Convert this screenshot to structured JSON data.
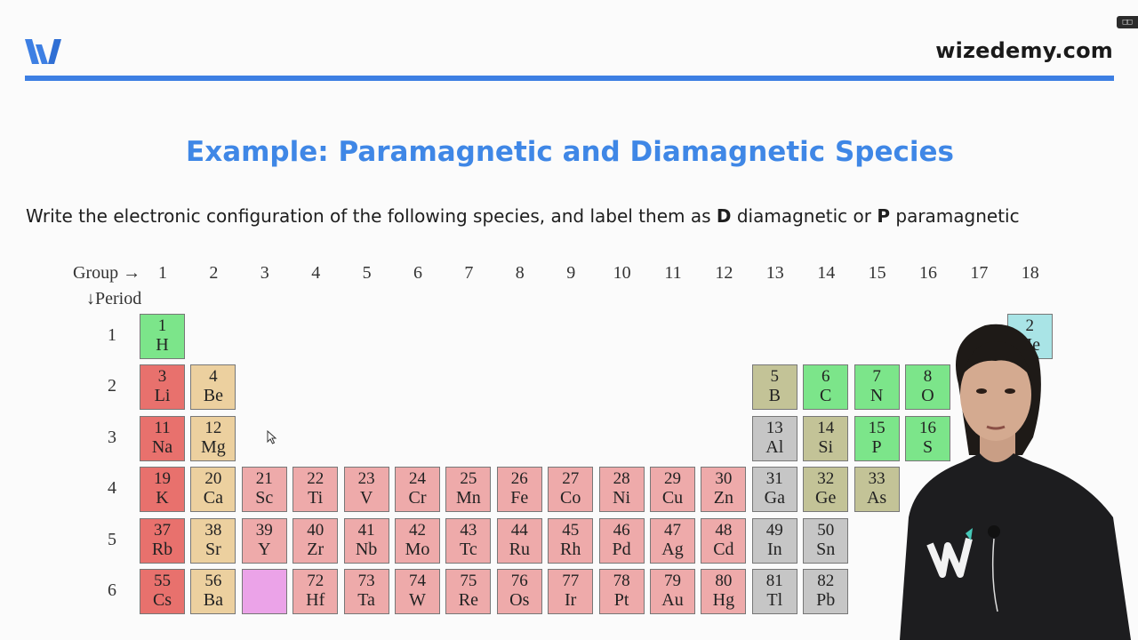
{
  "header": {
    "brand": "wizedemy.com",
    "logo_icon": "wizedemy-w-logo-icon",
    "accent_color": "#3d7fe3"
  },
  "slide": {
    "title": "Example: Paramagnetic and Diamagnetic Species",
    "question_part1": "Write the electronic configuration of the following species, and label them as ",
    "question_d": "D",
    "question_part2": " diamagnetic or ",
    "question_p": "P",
    "question_part3": " paramagnetic"
  },
  "table": {
    "group_label": "Group",
    "group_arrow": "→",
    "period_label": "Period",
    "period_arrow": "↓",
    "groups": [
      "1",
      "2",
      "3",
      "4",
      "5",
      "6",
      "7",
      "8",
      "9",
      "10",
      "11",
      "12",
      "13",
      "14",
      "15",
      "16",
      "17",
      "18"
    ],
    "periods": [
      "1",
      "2",
      "3",
      "4",
      "5",
      "6"
    ],
    "elements": [
      {
        "z": "1",
        "s": "H",
        "g": 1,
        "p": 1,
        "c": "nonmetal"
      },
      {
        "z": "2",
        "s": "He",
        "g": 18,
        "p": 1,
        "c": "noble"
      },
      {
        "z": "3",
        "s": "Li",
        "g": 1,
        "p": 2,
        "c": "alkali"
      },
      {
        "z": "4",
        "s": "Be",
        "g": 2,
        "p": 2,
        "c": "alkaline"
      },
      {
        "z": "5",
        "s": "B",
        "g": 13,
        "p": 2,
        "c": "metalloid"
      },
      {
        "z": "6",
        "s": "C",
        "g": 14,
        "p": 2,
        "c": "nonmetal"
      },
      {
        "z": "7",
        "s": "N",
        "g": 15,
        "p": 2,
        "c": "nonmetal"
      },
      {
        "z": "8",
        "s": "O",
        "g": 16,
        "p": 2,
        "c": "nonmetal"
      },
      {
        "z": "11",
        "s": "Na",
        "g": 1,
        "p": 3,
        "c": "alkali"
      },
      {
        "z": "12",
        "s": "Mg",
        "g": 2,
        "p": 3,
        "c": "alkaline"
      },
      {
        "z": "13",
        "s": "Al",
        "g": 13,
        "p": 3,
        "c": "post"
      },
      {
        "z": "14",
        "s": "Si",
        "g": 14,
        "p": 3,
        "c": "metalloid"
      },
      {
        "z": "15",
        "s": "P",
        "g": 15,
        "p": 3,
        "c": "nonmetal"
      },
      {
        "z": "16",
        "s": "S",
        "g": 16,
        "p": 3,
        "c": "nonmetal"
      },
      {
        "z": "19",
        "s": "K",
        "g": 1,
        "p": 4,
        "c": "alkali"
      },
      {
        "z": "20",
        "s": "Ca",
        "g": 2,
        "p": 4,
        "c": "alkaline"
      },
      {
        "z": "21",
        "s": "Sc",
        "g": 3,
        "p": 4,
        "c": "transition"
      },
      {
        "z": "22",
        "s": "Ti",
        "g": 4,
        "p": 4,
        "c": "transition"
      },
      {
        "z": "23",
        "s": "V",
        "g": 5,
        "p": 4,
        "c": "transition"
      },
      {
        "z": "24",
        "s": "Cr",
        "g": 6,
        "p": 4,
        "c": "transition"
      },
      {
        "z": "25",
        "s": "Mn",
        "g": 7,
        "p": 4,
        "c": "transition"
      },
      {
        "z": "26",
        "s": "Fe",
        "g": 8,
        "p": 4,
        "c": "transition"
      },
      {
        "z": "27",
        "s": "Co",
        "g": 9,
        "p": 4,
        "c": "transition"
      },
      {
        "z": "28",
        "s": "Ni",
        "g": 10,
        "p": 4,
        "c": "transition"
      },
      {
        "z": "29",
        "s": "Cu",
        "g": 11,
        "p": 4,
        "c": "transition"
      },
      {
        "z": "30",
        "s": "Zn",
        "g": 12,
        "p": 4,
        "c": "transition"
      },
      {
        "z": "31",
        "s": "Ga",
        "g": 13,
        "p": 4,
        "c": "post"
      },
      {
        "z": "32",
        "s": "Ge",
        "g": 14,
        "p": 4,
        "c": "metalloid"
      },
      {
        "z": "33",
        "s": "As",
        "g": 15,
        "p": 4,
        "c": "metalloid"
      },
      {
        "z": "37",
        "s": "Rb",
        "g": 1,
        "p": 5,
        "c": "alkali"
      },
      {
        "z": "38",
        "s": "Sr",
        "g": 2,
        "p": 5,
        "c": "alkaline"
      },
      {
        "z": "39",
        "s": "Y",
        "g": 3,
        "p": 5,
        "c": "transition"
      },
      {
        "z": "40",
        "s": "Zr",
        "g": 4,
        "p": 5,
        "c": "transition"
      },
      {
        "z": "41",
        "s": "Nb",
        "g": 5,
        "p": 5,
        "c": "transition"
      },
      {
        "z": "42",
        "s": "Mo",
        "g": 6,
        "p": 5,
        "c": "transition"
      },
      {
        "z": "43",
        "s": "Tc",
        "g": 7,
        "p": 5,
        "c": "transition"
      },
      {
        "z": "44",
        "s": "Ru",
        "g": 8,
        "p": 5,
        "c": "transition"
      },
      {
        "z": "45",
        "s": "Rh",
        "g": 9,
        "p": 5,
        "c": "transition"
      },
      {
        "z": "46",
        "s": "Pd",
        "g": 10,
        "p": 5,
        "c": "transition"
      },
      {
        "z": "47",
        "s": "Ag",
        "g": 11,
        "p": 5,
        "c": "transition"
      },
      {
        "z": "48",
        "s": "Cd",
        "g": 12,
        "p": 5,
        "c": "transition"
      },
      {
        "z": "49",
        "s": "In",
        "g": 13,
        "p": 5,
        "c": "post"
      },
      {
        "z": "50",
        "s": "Sn",
        "g": 14,
        "p": 5,
        "c": "post"
      },
      {
        "z": "55",
        "s": "Cs",
        "g": 1,
        "p": 6,
        "c": "alkali"
      },
      {
        "z": "56",
        "s": "Ba",
        "g": 2,
        "p": 6,
        "c": "alkaline"
      },
      {
        "z": "",
        "s": "",
        "g": 3,
        "p": 6,
        "c": "lanth"
      },
      {
        "z": "72",
        "s": "Hf",
        "g": 4,
        "p": 6,
        "c": "transition"
      },
      {
        "z": "73",
        "s": "Ta",
        "g": 5,
        "p": 6,
        "c": "transition"
      },
      {
        "z": "74",
        "s": "W",
        "g": 6,
        "p": 6,
        "c": "transition"
      },
      {
        "z": "75",
        "s": "Re",
        "g": 7,
        "p": 6,
        "c": "transition"
      },
      {
        "z": "76",
        "s": "Os",
        "g": 8,
        "p": 6,
        "c": "transition"
      },
      {
        "z": "77",
        "s": "Ir",
        "g": 9,
        "p": 6,
        "c": "transition"
      },
      {
        "z": "78",
        "s": "Pt",
        "g": 10,
        "p": 6,
        "c": "transition"
      },
      {
        "z": "79",
        "s": "Au",
        "g": 11,
        "p": 6,
        "c": "transition"
      },
      {
        "z": "80",
        "s": "Hg",
        "g": 12,
        "p": 6,
        "c": "transition"
      },
      {
        "z": "81",
        "s": "Tl",
        "g": 13,
        "p": 6,
        "c": "post"
      },
      {
        "z": "82",
        "s": "Pb",
        "g": 14,
        "p": 6,
        "c": "post"
      }
    ]
  }
}
